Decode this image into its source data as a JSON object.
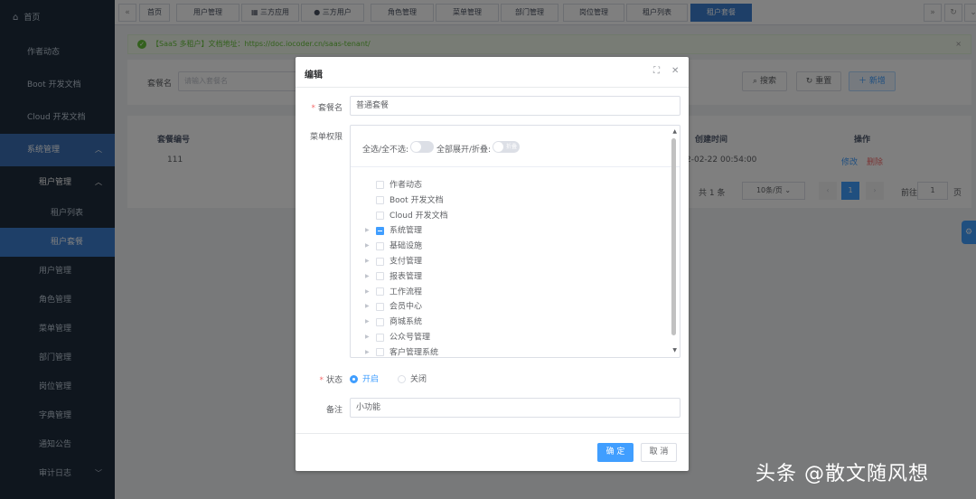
{
  "sidebar": {
    "items": [
      {
        "label": "首页",
        "icon": "home-icon"
      },
      {
        "label": "作者动态"
      },
      {
        "label": "Boot 开发文档"
      },
      {
        "label": "Cloud 开发文档"
      },
      {
        "label": "系统管理"
      },
      {
        "label": "租户管理"
      },
      {
        "label": "租户列表"
      },
      {
        "label": "租户套餐"
      },
      {
        "label": "用户管理"
      },
      {
        "label": "角色管理"
      },
      {
        "label": "菜单管理"
      },
      {
        "label": "部门管理"
      },
      {
        "label": "岗位管理"
      },
      {
        "label": "字典管理"
      },
      {
        "label": "通知公告"
      },
      {
        "label": "审计日志"
      }
    ]
  },
  "tabs": [
    "首页",
    "用户管理",
    "三方应用",
    "三方用户",
    "角色管理",
    "菜单管理",
    "部门管理",
    "岗位管理",
    "租户列表",
    "租户套餐"
  ],
  "alert": {
    "text": "【SaaS 多租户】文档地址：https://doc.iocoder.cn/saas-tenant/"
  },
  "search": {
    "name_label": "套餐名",
    "name_placeholder": "请输入套餐名",
    "search_btn": "搜索",
    "reset_btn": "重置",
    "add_btn": "新增"
  },
  "table": {
    "headers": {
      "id": "套餐编号",
      "created": "创建时间",
      "ops": "操作"
    },
    "rows": [
      {
        "id": "111",
        "created": "2-02-22 00:54:00",
        "edit": "修改",
        "delete": "删除"
      }
    ],
    "total": "共 1 条",
    "page_size": "10条/页",
    "current_page": "1",
    "goto_label": "前往",
    "goto_value": "1",
    "page_unit": "页"
  },
  "dialog": {
    "title": "编辑",
    "name_label": "套餐名",
    "name_value": "普通套餐",
    "menu_label": "菜单权限",
    "select_all_label": "全选/全不选:",
    "expand_label": "全部展开/折叠:",
    "expand_switch_text": "折叠",
    "tree": [
      {
        "label": "作者动态",
        "caret": false,
        "state": "none"
      },
      {
        "label": "Boot 开发文档",
        "caret": false,
        "state": "none"
      },
      {
        "label": "Cloud 开发文档",
        "caret": false,
        "state": "none"
      },
      {
        "label": "系统管理",
        "caret": true,
        "state": "indeterminate"
      },
      {
        "label": "基础设施",
        "caret": true,
        "state": "none"
      },
      {
        "label": "支付管理",
        "caret": true,
        "state": "none"
      },
      {
        "label": "报表管理",
        "caret": true,
        "state": "none"
      },
      {
        "label": "工作流程",
        "caret": true,
        "state": "none"
      },
      {
        "label": "会员中心",
        "caret": true,
        "state": "none"
      },
      {
        "label": "商城系统",
        "caret": true,
        "state": "none"
      },
      {
        "label": "公众号管理",
        "caret": true,
        "state": "none"
      },
      {
        "label": "客户管理系统",
        "caret": true,
        "state": "none"
      }
    ],
    "status_label": "状态",
    "status_on": "开启",
    "status_off": "关闭",
    "remark_label": "备注",
    "remark_value": "小功能",
    "confirm": "确 定",
    "cancel": "取 消"
  },
  "watermark": "头条 @散文随风想",
  "colors": {
    "primary": "#409eff",
    "sidebar": "#1f2d3d",
    "success": "#67c23a",
    "danger": "#f56c6c"
  }
}
